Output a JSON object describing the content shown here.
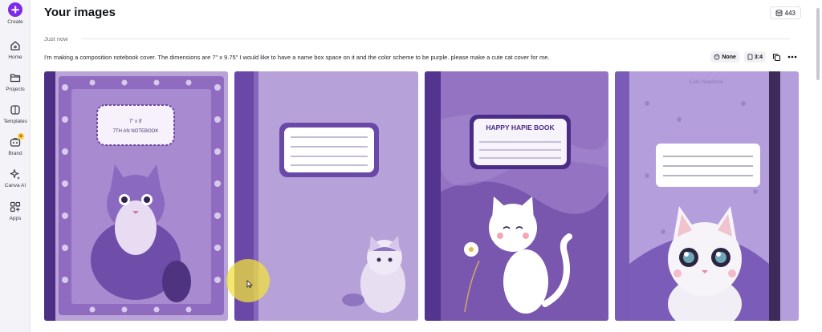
{
  "sidebar": {
    "items": [
      {
        "label": "Create",
        "icon": "plus-icon"
      },
      {
        "label": "Home",
        "icon": "home-icon"
      },
      {
        "label": "Projects",
        "icon": "folder-icon"
      },
      {
        "label": "Templates",
        "icon": "templates-icon"
      },
      {
        "label": "Brand",
        "icon": "brand-icon"
      },
      {
        "label": "Canva AI",
        "icon": "sparkle-icon"
      },
      {
        "label": "Apps",
        "icon": "apps-icon"
      }
    ],
    "accent": "#7d2ae8"
  },
  "header": {
    "title": "Your images",
    "count": "443"
  },
  "group": {
    "time_label": "Just now",
    "prompt": "I'm making a composition notebook cover. The dimensions are 7\" x 9.75\" I would like to have a name box space on it and the color scheme to be purple. please make a cute cat cover for me.",
    "style_chip": "None",
    "ratio_chip": "3:4"
  },
  "images": [
    {
      "id": "card-1",
      "label_line1": "7\" x 9'",
      "label_line2": "7TH AN NOTEBOOK"
    },
    {
      "id": "card-2"
    },
    {
      "id": "card-3",
      "label_title": "HAPPY HAPIE BOOK"
    },
    {
      "id": "card-4",
      "label_title": "Cute Notebook"
    }
  ],
  "colors": {
    "purple_dark": "#5a3a8c",
    "purple_mid": "#8f6cbf",
    "purple_light": "#b9a3d8",
    "highlight": "#f0e23c"
  }
}
